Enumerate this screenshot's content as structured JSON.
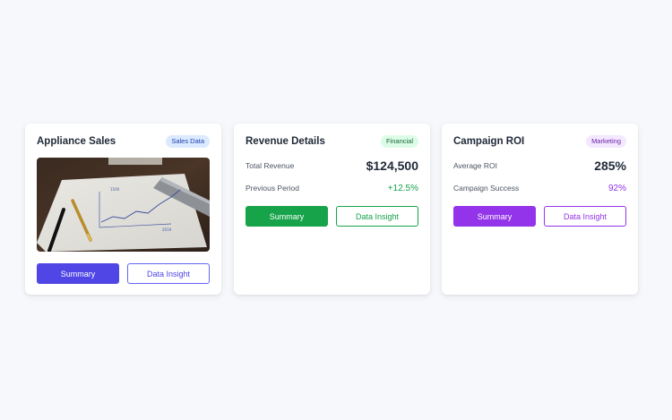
{
  "colors": {
    "page_bg": "#f6f8fb",
    "indigo": "#4f46e5",
    "green": "#16a34a",
    "purple": "#9333ea"
  },
  "cards": [
    {
      "title": "Appliance Sales",
      "badge": "Sales Data",
      "image": "business chart on paper with pens and ruler",
      "summary_label": "Summary",
      "insight_label": "Data Insight"
    },
    {
      "title": "Revenue Details",
      "badge": "Financial",
      "metrics": [
        {
          "label": "Total Revenue",
          "value": "$124,500"
        },
        {
          "label": "Previous Period",
          "value": "+12.5%"
        }
      ],
      "summary_label": "Summary",
      "insight_label": "Data Insight"
    },
    {
      "title": "Campaign ROI",
      "badge": "Marketing",
      "metrics": [
        {
          "label": "Average ROI",
          "value": "285%"
        },
        {
          "label": "Campaign Success",
          "value": "92%"
        }
      ],
      "summary_label": "Summary",
      "insight_label": "Data Insight"
    }
  ]
}
